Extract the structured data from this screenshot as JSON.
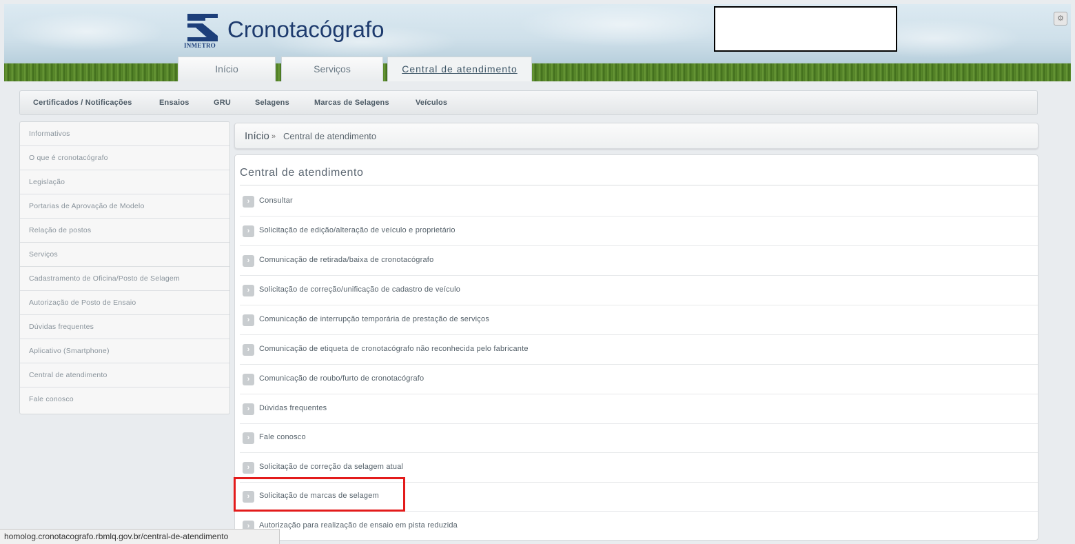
{
  "header": {
    "logo_text": "INMETRO",
    "site_title": "Cronotacógrafo",
    "corner_icon": "gear-icon",
    "tabs": [
      {
        "label": "Início",
        "active": false
      },
      {
        "label": "Serviços",
        "active": false
      },
      {
        "label": "Central de atendimento",
        "active": true
      }
    ]
  },
  "subnav": {
    "items": [
      "Certificados / Notificações",
      "Ensaios",
      "GRU",
      "Selagens",
      "Marcas de Selagens",
      "Veículos"
    ]
  },
  "sidebar": {
    "items": [
      "Informativos",
      "O que é cronotacógrafo",
      "Legislação",
      "Portarias de Aprovação de Modelo",
      "Relação de postos",
      "Serviços",
      "Cadastramento de Oficina/Posto de Selagem",
      "Autorização de Posto de Ensaio",
      "Dúvidas frequentes",
      "Aplicativo (Smartphone)",
      "Central de atendimento",
      "Fale conosco"
    ]
  },
  "breadcrumb": {
    "home": "Início",
    "separator": "»",
    "current": "Central de atendimento"
  },
  "main": {
    "title": "Central de atendimento",
    "highlight_color": "#e31b1b",
    "items": [
      "Consultar",
      "Solicitação de edição/alteração de veículo e proprietário",
      "Comunicação de retirada/baixa de cronotacógrafo",
      "Solicitação de correção/unificação de cadastro de veículo",
      "Comunicação de interrupção temporária de prestação de serviços",
      "Comunicação de etiqueta de cronotacógrafo não reconhecida pelo fabricante",
      "Comunicação de roubo/furto de cronotacógrafo",
      "Dúvidas frequentes",
      "Fale conosco",
      "Solicitação de correção da selagem atual",
      "Solicitação de marcas de selagem",
      "Autorização para realização de ensaio em pista reduzida"
    ]
  },
  "statusbar": {
    "url": "homolog.cronotacografo.rbmlq.gov.br/central-de-atendimento"
  }
}
